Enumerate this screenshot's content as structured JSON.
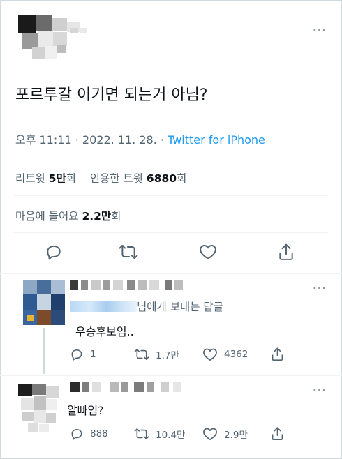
{
  "tweet": {
    "text": "포르투갈 이기면 되는거 아님?",
    "time": "오후 11:11",
    "separator": "·",
    "date": "2022. 11. 28.",
    "source": "Twitter for iPhone",
    "more_icon": "more-icon"
  },
  "stats": {
    "retweets_label": "리트윗",
    "retweets_value": "5만",
    "retweets_suffix": "회",
    "quotes_label": "인용한 트윗",
    "quotes_value": "6880",
    "quotes_suffix": "회",
    "likes_label": "마음에 들어요",
    "likes_value": "2.2만",
    "likes_suffix": "회"
  },
  "actions": [
    "reply-icon",
    "retweet-icon",
    "like-icon",
    "share-icon"
  ],
  "replies": [
    {
      "replying_suffix": "님에게 보내는 답글",
      "text": "우승후보임..",
      "reply_count": "1",
      "retweet_count": "1.7만",
      "like_count": "4362"
    },
    {
      "text": "알빠임?",
      "reply_count": "888",
      "retweet_count": "10.4만",
      "like_count": "2.9만"
    }
  ],
  "colors": {
    "accent": "#1d9bf0",
    "secondary_text": "#536471",
    "primary_text": "#0f1419",
    "divider": "#eff3f4"
  }
}
